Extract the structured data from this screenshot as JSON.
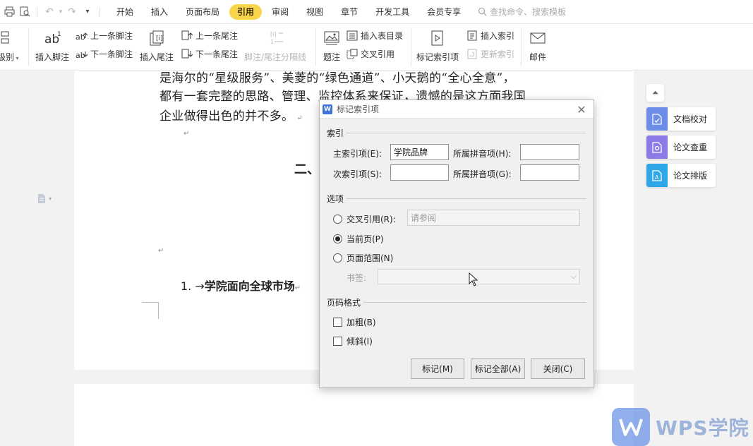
{
  "quick_access": {
    "icons": [
      "print-icon",
      "print-preview-icon",
      "undo-icon",
      "redo-icon",
      "more-icon"
    ]
  },
  "tabs": [
    {
      "label": "开始",
      "active": false
    },
    {
      "label": "插入",
      "active": false
    },
    {
      "label": "页面布局",
      "active": false
    },
    {
      "label": "引用",
      "active": true
    },
    {
      "label": "审阅",
      "active": false
    },
    {
      "label": "视图",
      "active": false
    },
    {
      "label": "章节",
      "active": false
    },
    {
      "label": "开发工具",
      "active": false
    },
    {
      "label": "会员专享",
      "active": false
    }
  ],
  "search": {
    "placeholder": "查找命令、搜索模板"
  },
  "ribbon": {
    "level": "级别",
    "insert_footnote": "插入脚注",
    "prev_footnote": "上一条脚注",
    "next_footnote": "下一条脚注",
    "insert_endnote": "插入尾注",
    "prev_endnote": "上一条尾注",
    "next_endnote": "下一条尾注",
    "note_separator": "脚注/尾注分隔线",
    "caption": "题注",
    "insert_table_of_figures": "插入表目录",
    "cross_reference": "交叉引用",
    "mark_index_entry": "标记索引项",
    "insert_index": "插入索引",
    "update_index": "更新索引",
    "mail": "邮件"
  },
  "document": {
    "lines": [
      "是海尔的“星级服务”、美菱的“绿色通道”、小天鹅的“全心全意”，",
      "都有一套完整的思路、管理、监控体系来保证，遗憾的是这方面我国",
      "企业做得出色的并不多。"
    ],
    "paragraph_mark": "↵",
    "heading2": "二、",
    "list_number": "1. →",
    "list_text": "学院面向全球市场"
  },
  "side_panel": {
    "items": [
      {
        "label": "文档校对",
        "color": "#6b8de8"
      },
      {
        "label": "论文查重",
        "color": "#8b7be6"
      },
      {
        "label": "论文排版",
        "color": "#2fa6e8"
      }
    ]
  },
  "watermark": {
    "brand": "WPS学院"
  },
  "dialog": {
    "title": "标记索引项",
    "group_index": "索引",
    "main_entry_label": "主索引项(E):",
    "main_entry_value": "学院品牌",
    "main_pinyin_label": "所属拼音项(H):",
    "main_pinyin_value": "",
    "sub_entry_label": "次索引项(S):",
    "sub_entry_value": "",
    "sub_pinyin_label": "所属拼音项(G):",
    "sub_pinyin_value": "",
    "group_options": "选项",
    "cross_ref_label": "交叉引用(R):",
    "cross_ref_placeholder": "请参阅",
    "current_page_label": "当前页(P)",
    "page_range_label": "页面范围(N)",
    "bookmark_label": "书签:",
    "selected_option": "current_page",
    "group_format": "页码格式",
    "bold_label": "加粗(B)",
    "italic_label": "倾斜(I)",
    "bold_checked": false,
    "italic_checked": false,
    "mark_button": "标记(M)",
    "mark_all_button": "标记全部(A)",
    "close_button": "关闭(C)"
  }
}
